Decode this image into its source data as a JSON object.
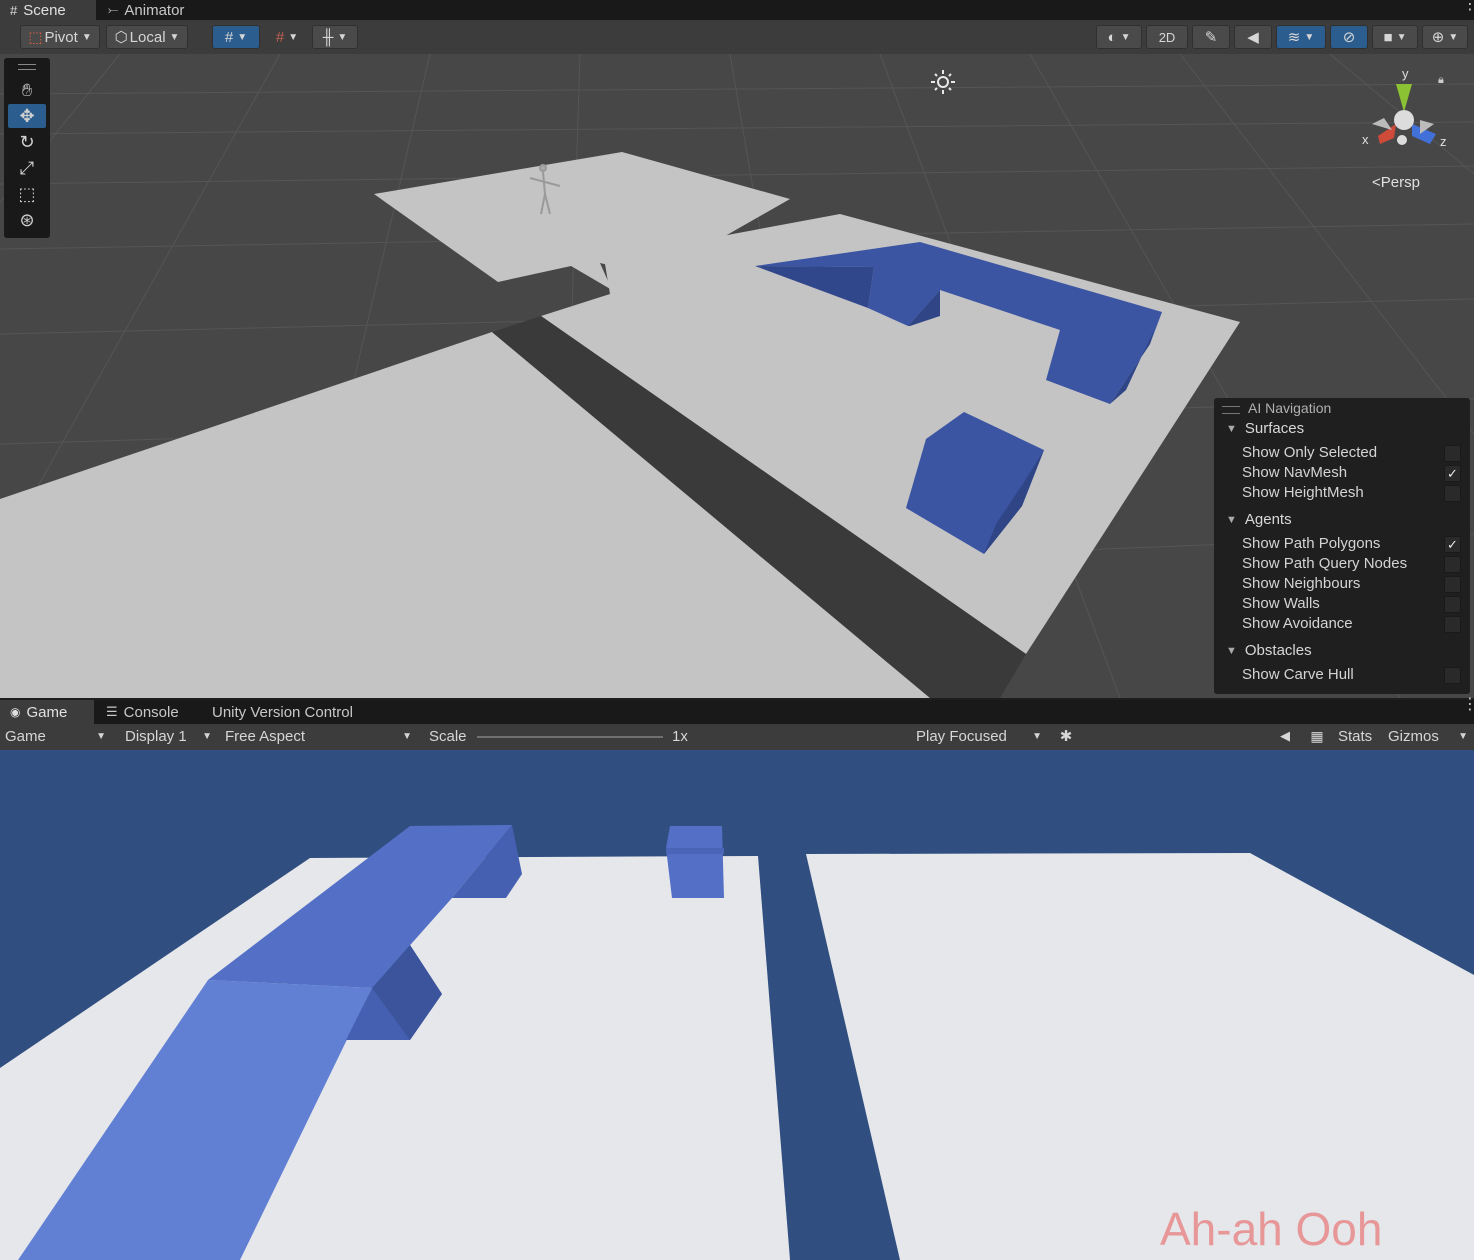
{
  "scene_tabs": [
    {
      "label": "Scene",
      "icon": "grid-hash-icon"
    },
    {
      "label": "Animator",
      "icon": "animator-icon"
    }
  ],
  "scene_toolbar": {
    "pivot_label": "Pivot",
    "local_label": "Local",
    "mode_2d_label": "2D"
  },
  "scene_view": {
    "persp_label": "Persp",
    "axis_x": "x",
    "axis_y": "y",
    "axis_z": "z",
    "colors": {
      "ground": "#c4c4c4",
      "navmesh": "#3b55a3",
      "grid_bg": "#474747"
    }
  },
  "ai_navigation": {
    "title": "AI Navigation",
    "sections": [
      {
        "label": "Surfaces",
        "options": [
          {
            "label": "Show Only Selected",
            "checked": false
          },
          {
            "label": "Show NavMesh",
            "checked": true
          },
          {
            "label": "Show HeightMesh",
            "checked": false
          }
        ]
      },
      {
        "label": "Agents",
        "options": [
          {
            "label": "Show Path Polygons",
            "checked": true
          },
          {
            "label": "Show Path Query Nodes",
            "checked": false
          },
          {
            "label": "Show Neighbours",
            "checked": false
          },
          {
            "label": "Show Walls",
            "checked": false
          },
          {
            "label": "Show Avoidance",
            "checked": false
          }
        ]
      },
      {
        "label": "Obstacles",
        "options": [
          {
            "label": "Show Carve Hull",
            "checked": false
          }
        ]
      }
    ]
  },
  "game_tabs": [
    {
      "label": "Game",
      "icon": "gamepad-icon"
    },
    {
      "label": "Console",
      "icon": "console-icon"
    },
    {
      "label": "Unity Version Control",
      "icon": ""
    }
  ],
  "game_toolbar": {
    "game_select": "Game",
    "display_select": "Display 1",
    "aspect_select": "Free Aspect",
    "scale_label": "Scale",
    "scale_value": "1x",
    "play_mode_select": "Play Focused",
    "stats_label": "Stats",
    "gizmos_label": "Gizmos"
  },
  "game_view": {
    "watermark": "Ah-ah Ooh",
    "colors": {
      "sky": "#304f80",
      "floor": "#e6e7ea",
      "cube": "#5470c6"
    }
  }
}
